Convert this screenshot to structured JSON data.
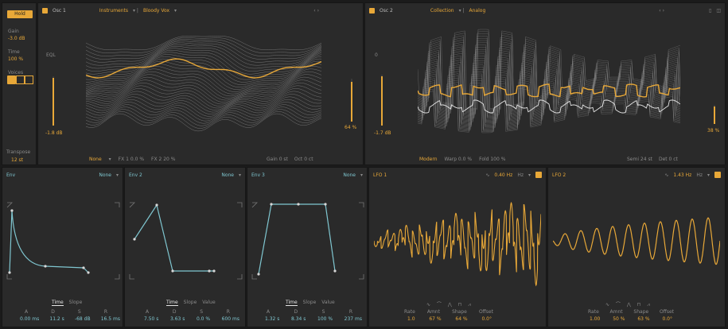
{
  "left": {
    "button": "Hold",
    "gain_label": "Gain",
    "gain_value": "-3.0 dB",
    "time_label": "Time",
    "time_value": "100 %",
    "voices_label": "Voices",
    "transpose_label": "Transpose",
    "transpose_value": "12 st"
  },
  "osc1": {
    "title": "Osc 1",
    "source": "Instruments",
    "preset": "Bloody Vox",
    "level_top": "EQL",
    "level_value": "-1.8 dB",
    "right_value": "64 %",
    "mode": "None",
    "fx1": "FX 1 0.0 %",
    "fx2": "FX 2 20 %",
    "gain": "Gain 0 st",
    "oct": "Oct 0 ct"
  },
  "osc2": {
    "title": "Osc 2",
    "source": "Collection",
    "preset": "Analog",
    "level_top": "0",
    "level_value": "-1.7 dB",
    "right_value": "38 %",
    "mode": "Modern",
    "warp": "Warp 0.0 %",
    "fold": "Fold 100 %",
    "semi": "Semi 24 st",
    "det": "Det 0 ct"
  },
  "env1": {
    "title": "Env",
    "mode": "None",
    "tabs": [
      "Time",
      "Slope"
    ],
    "labels": [
      "A",
      "D",
      "S",
      "R"
    ],
    "values": [
      "0.00 ms",
      "11.2 s",
      "-68 dB",
      "16.5 ms"
    ]
  },
  "env2": {
    "title": "Env 2",
    "mode": "None",
    "tabs": [
      "Time",
      "Slope",
      "Value"
    ],
    "labels": [
      "A",
      "D",
      "S",
      "R"
    ],
    "values": [
      "7.50 s",
      "3.63 s",
      "0.0 %",
      "600 ms"
    ]
  },
  "env3": {
    "title": "Env 3",
    "mode": "None",
    "tabs": [
      "Time",
      "Slope",
      "Value"
    ],
    "labels": [
      "A",
      "D",
      "S",
      "R"
    ],
    "values": [
      "1.32 s",
      "8.34 s",
      "100 %",
      "237 ms"
    ]
  },
  "lfo1": {
    "title": "LFO 1",
    "rate_top": "0.40 Hz",
    "knobs": [
      "Rate",
      "Amnt",
      "Shape",
      "Offset"
    ],
    "values": [
      "1.0",
      "67 %",
      "64 %",
      "0.0°"
    ]
  },
  "lfo2": {
    "title": "LFO 2",
    "rate_top": "1.43 Hz",
    "knobs": [
      "Rate",
      "Amnt",
      "Shape",
      "Offset"
    ],
    "values": [
      "1.00",
      "50 %",
      "63 %",
      "0.0°"
    ]
  },
  "colors": {
    "accent": "#e8a838",
    "envelope": "#7fc6d0",
    "panel": "#2a2a2a",
    "background": "#1b1b1b"
  }
}
